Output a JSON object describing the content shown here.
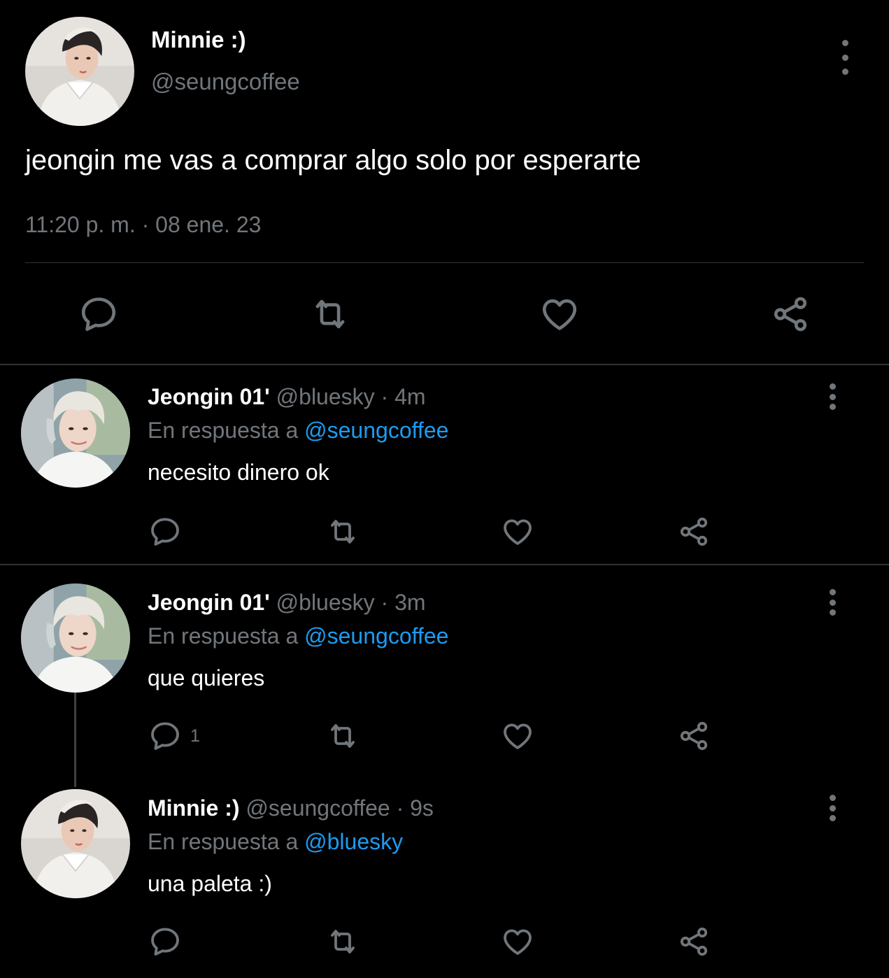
{
  "main_tweet": {
    "author_name": "Minnie :)",
    "author_handle": "@seungcoffee",
    "text": "jeongin me vas a comprar algo solo por esperarte",
    "timestamp": "11:20 p. m. · 08 ene. 23",
    "avatar_icon": "avatar-photo",
    "actions": [
      "reply-icon",
      "retweet-icon",
      "like-icon",
      "share-icon"
    ]
  },
  "replies": [
    {
      "author_name": "Jeongin 01'",
      "author_handle": "@bluesky",
      "time": "· 4m",
      "reply_prefix": "En respuesta a",
      "reply_to": "@seungcoffee",
      "text": "necesito dinero ok",
      "reply_count": ""
    },
    {
      "author_name": "Jeongin 01'",
      "author_handle": "@bluesky",
      "time": "· 3m",
      "reply_prefix": "En respuesta a",
      "reply_to": "@seungcoffee",
      "text": "que quieres",
      "reply_count": "1"
    },
    {
      "author_name": "Minnie :)",
      "author_handle": "@seungcoffee",
      "time": "· 9s",
      "reply_prefix": "En respuesta a",
      "reply_to": "@bluesky",
      "text": "una paleta :)",
      "reply_count": ""
    }
  ],
  "colors": {
    "background": "#000000",
    "text_primary": "#ffffff",
    "text_secondary": "#71767b",
    "accent": "#1d9bf0",
    "divider": "#2f3336"
  }
}
